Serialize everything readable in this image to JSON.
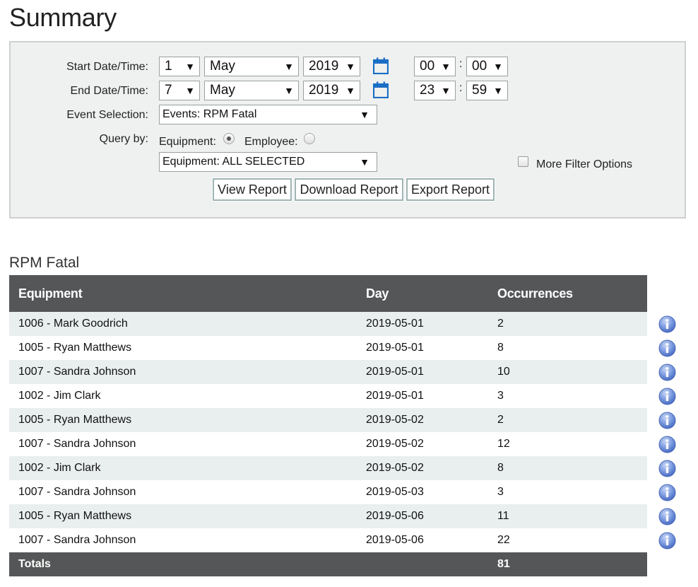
{
  "page": {
    "title": "Summary"
  },
  "filters": {
    "start_label": "Start Date/Time:",
    "end_label": "End Date/Time:",
    "event_label": "Event Selection:",
    "query_label": "Query by:",
    "start": {
      "day": "1",
      "month": "May",
      "year": "2019",
      "hour": "00",
      "minute": "00"
    },
    "end": {
      "day": "7",
      "month": "May",
      "year": "2019",
      "hour": "23",
      "minute": "59"
    },
    "colon": ":",
    "event_selection": "Events: RPM Fatal",
    "query_by": {
      "equipment_label": "Equipment:",
      "employee_label": "Employee:",
      "selected": "equipment"
    },
    "equipment_selection": "Equipment: ALL SELECTED",
    "more_filter_label": "More Filter Options",
    "arrow": "▼",
    "buttons": {
      "view": "View Report",
      "download": "Download Report",
      "export": "Export Report"
    }
  },
  "report": {
    "title": "RPM Fatal",
    "columns": [
      "Equipment",
      "Day",
      "Occurrences"
    ],
    "rows": [
      [
        "1006 - Mark Goodrich",
        "2019-05-01",
        "2"
      ],
      [
        "1005 - Ryan Matthews",
        "2019-05-01",
        "8"
      ],
      [
        "1007 - Sandra Johnson",
        "2019-05-01",
        "10"
      ],
      [
        "1002 - Jim Clark",
        "2019-05-01",
        "3"
      ],
      [
        "1005 - Ryan Matthews",
        "2019-05-02",
        "2"
      ],
      [
        "1007 - Sandra Johnson",
        "2019-05-02",
        "12"
      ],
      [
        "1002 - Jim Clark",
        "2019-05-02",
        "8"
      ],
      [
        "1007 - Sandra Johnson",
        "2019-05-03",
        "3"
      ],
      [
        "1005 - Ryan Matthews",
        "2019-05-06",
        "11"
      ],
      [
        "1007 - Sandra Johnson",
        "2019-05-06",
        "22"
      ]
    ],
    "totals_label": "Totals",
    "totals_value": "81",
    "row_icon": "info-icon"
  },
  "colors": {
    "header_bg": "#555657",
    "row_alt": "#e9eeee",
    "panel_bg": "#eff0f0",
    "calendar_blue": "#1a6fc4",
    "info_blue": "#5a7fd1"
  }
}
